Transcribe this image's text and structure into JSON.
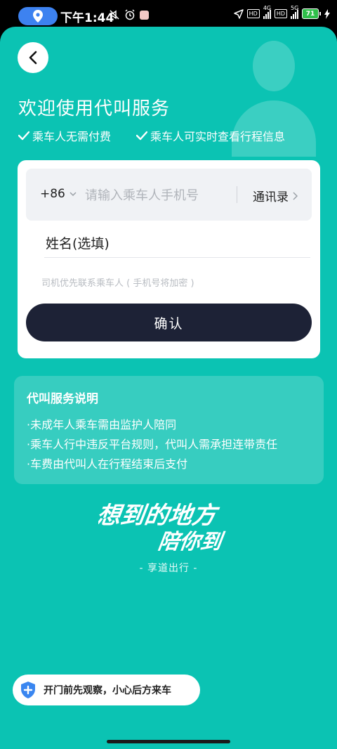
{
  "status_bar": {
    "time": "下午1:44",
    "net1": "4G",
    "net2": "5G",
    "hd": "HD",
    "battery": "71"
  },
  "header": {
    "title": "欢迎使用代叫服务"
  },
  "features": [
    "乘车人无需付费",
    "乘车人可实时查看行程信息"
  ],
  "form": {
    "country_code": "+86",
    "phone_placeholder": "请输入乘车人手机号",
    "phone_value": "",
    "contacts_label": "通讯录",
    "name_placeholder": "姓名(选填)",
    "name_value": "",
    "hint": "司机优先联系乘车人 ( 手机号将加密 )",
    "confirm_label": "确认"
  },
  "service_info": {
    "title": "代叫服务说明",
    "items": [
      "·未成年人乘车需由监护人陪同",
      "·乘车人行中违反平台规则，代叫人需承担连带责任",
      "·车费由代叫人在行程结束后支付"
    ]
  },
  "slogan": {
    "line1": "想到的地方",
    "line2": "陪你到"
  },
  "brand": "- 享道出行 -",
  "toast": {
    "text": "开门前先观察，小心后方来车"
  },
  "colors": {
    "background": "#0bc3b3",
    "button": "#1d2236",
    "location_pill": "#3d82f0"
  }
}
